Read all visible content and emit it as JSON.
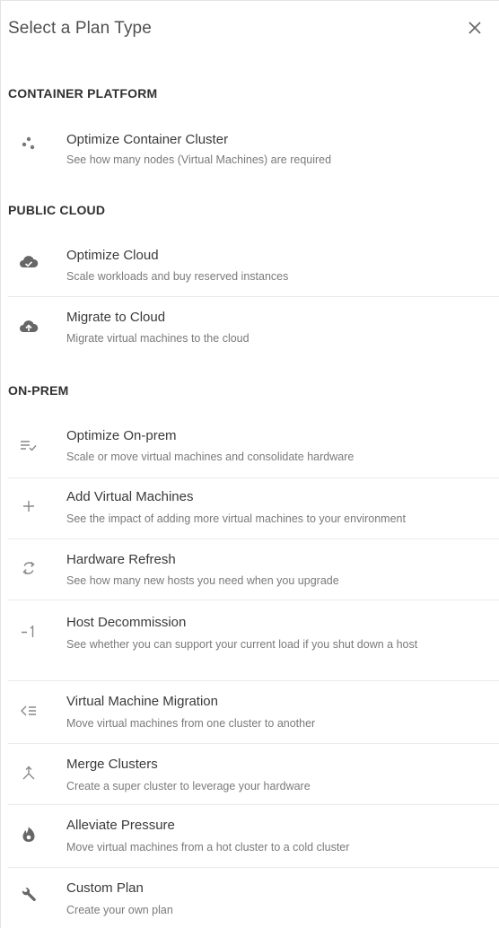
{
  "dialog": {
    "title": "Select a Plan Type",
    "close_icon": "close-icon"
  },
  "sections": [
    {
      "title": "CONTAINER PLATFORM",
      "items": [
        {
          "name": "Optimize Container Cluster",
          "desc": "See how many nodes (Virtual Machines) are required",
          "icon": "container-cluster-icon"
        }
      ]
    },
    {
      "title": "PUBLIC CLOUD",
      "items": [
        {
          "name": "Optimize Cloud",
          "desc": "Scale workloads and buy reserved instances",
          "icon": "cloud-check-icon"
        },
        {
          "name": "Migrate to Cloud",
          "desc": "Migrate virtual machines to the cloud",
          "icon": "cloud-upload-icon"
        }
      ]
    },
    {
      "title": "ON-PREM",
      "items": [
        {
          "name": "Optimize On-prem",
          "desc": "Scale or move virtual machines and consolidate hardware",
          "icon": "list-check-icon"
        },
        {
          "name": "Add Virtual Machines",
          "desc": "See the impact of adding more virtual machines to your environment",
          "icon": "plus-icon"
        },
        {
          "name": "Hardware Refresh",
          "desc": "See how many new hosts you need when you upgrade",
          "icon": "refresh-icon"
        },
        {
          "name": "Host Decommission",
          "desc": "See whether you can support your current load if you shut down a host",
          "icon": "minus-one-icon"
        },
        {
          "name": "Virtual Machine Migration",
          "desc": "Move virtual machines from one cluster to another",
          "icon": "migration-icon"
        },
        {
          "name": "Merge Clusters",
          "desc": "Create a super cluster to leverage your hardware",
          "icon": "merge-icon"
        },
        {
          "name": "Alleviate Pressure",
          "desc": "Move virtual machines from a hot cluster to a cold cluster",
          "icon": "flame-icon"
        },
        {
          "name": "Custom Plan",
          "desc": "Create your own plan",
          "icon": "wrench-icon"
        }
      ]
    }
  ]
}
